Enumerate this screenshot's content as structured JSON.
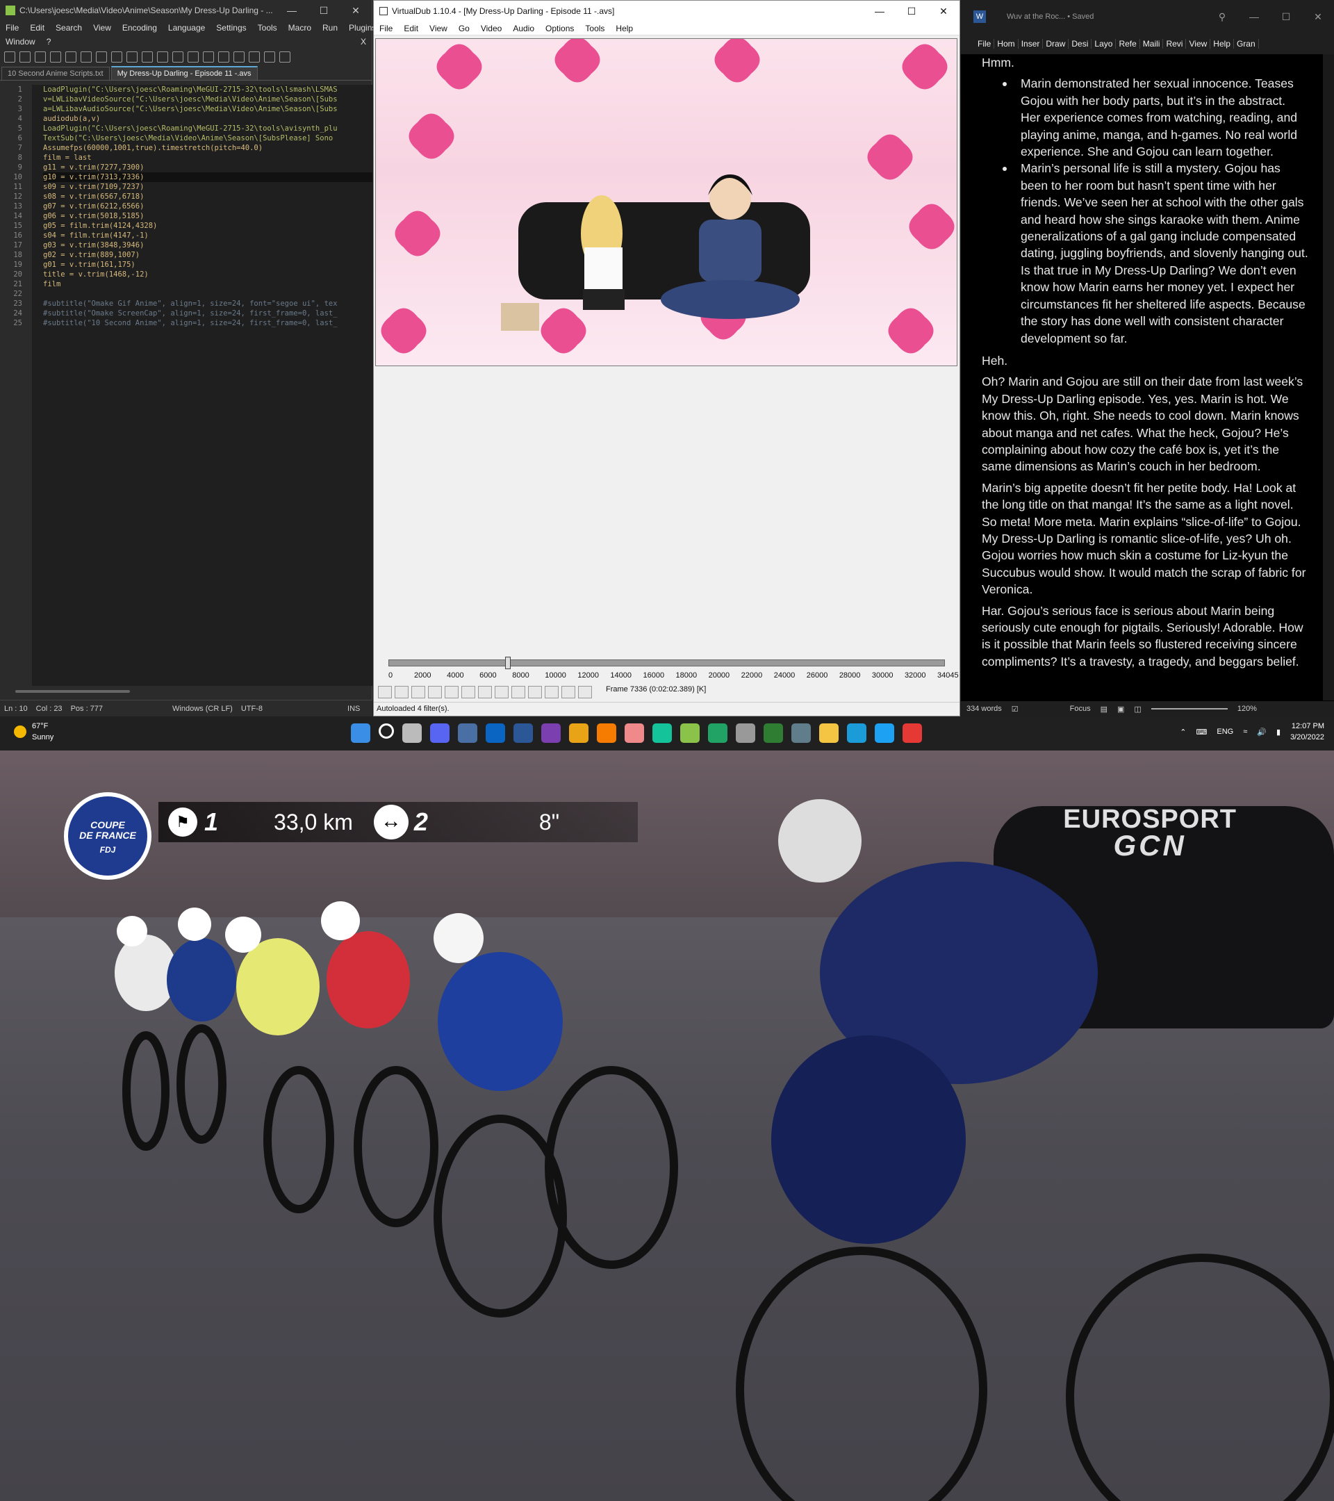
{
  "notepadpp": {
    "title": "C:\\Users\\joesc\\Media\\Video\\Anime\\Season\\My Dress-Up Darling - ...",
    "menu": [
      "File",
      "Edit",
      "Search",
      "View",
      "Encoding",
      "Language",
      "Settings",
      "Tools",
      "Macro",
      "Run",
      "Plugins",
      "Window",
      "?"
    ],
    "menu_close": "X",
    "tabs": [
      "10 Second Anime Scripts.txt",
      "My Dress-Up Darling - Episode 11 -.avs"
    ],
    "line_numbers": [
      "1",
      "2",
      "3",
      "4",
      "5",
      "6",
      "7",
      "8",
      "9",
      "10",
      "11",
      "12",
      "13",
      "14",
      "15",
      "16",
      "17",
      "18",
      "19",
      "20",
      "21",
      "22",
      "23",
      "24",
      "25"
    ],
    "code": [
      "LoadPlugin(\"C:\\Users\\joesc\\Roaming\\MeGUI-2715-32\\tools\\lsmash\\LSMAS",
      "v=LWLibavVideoSource(\"C:\\Users\\joesc\\Media\\Video\\Anime\\Season\\[Subs",
      "a=LWLibavAudioSource(\"C:\\Users\\joesc\\Media\\Video\\Anime\\Season\\[Subs",
      "audiodub(a,v)",
      "LoadPlugin(\"C:\\Users\\joesc\\Roaming\\MeGUI-2715-32\\tools\\avisynth_plu",
      "TextSub(\"C:\\Users\\joesc\\Media\\Video\\Anime\\Season\\[SubsPlease] Sono",
      "Assumefps(60000,1001,true).timestretch(pitch=40.0)",
      "film = last",
      "g11 = v.trim(7277,7300)",
      "g10 = v.trim(7313,7336)",
      "s09 = v.trim(7109,7237)",
      "s08 = v.trim(6567,6718)",
      "g07 = v.trim(6212,6566)",
      "g06 = v.trim(5018,5185)",
      "g05 = film.trim(4124,4328)",
      "s04 = film.trim(4147,-1)",
      "g03 = v.trim(3848,3946)",
      "g02 = v.trim(889,1007)",
      "g01 = v.trim(161,175)",
      "title = v.trim(1468,-12)",
      "film",
      "",
      "#subtitle(\"Omake Gif Anime\", align=1, size=24, font=\"segoe ui\", tex",
      "#subtitle(\"Omake ScreenCap\", align=1, size=24, first_frame=0, last_",
      "#subtitle(\"10 Second Anime\", align=1, size=24, first_frame=0, last_"
    ],
    "status": {
      "ln": "Ln : 10",
      "col": "Col : 23",
      "pos": "Pos : 777",
      "eol": "Windows (CR LF)",
      "enc": "UTF-8",
      "mode": "INS"
    }
  },
  "vdub": {
    "title": "VirtualDub 1.10.4 - [My Dress-Up Darling - Episode 11 -.avs]",
    "menu": [
      "File",
      "Edit",
      "View",
      "Go",
      "Video",
      "Audio",
      "Options",
      "Tools",
      "Help"
    ],
    "ticks": [
      "0",
      "2000",
      "4000",
      "6000",
      "8000",
      "10000",
      "12000",
      "14000",
      "16000",
      "18000",
      "20000",
      "22000",
      "24000",
      "26000",
      "28000",
      "30000",
      "32000",
      "34045"
    ],
    "frame_info": "Frame 7336 (0:02:02.389) [K]",
    "status": "Autoloaded 4 filter(s).",
    "position_fraction": 0.2155
  },
  "word": {
    "title": "Wuv at the Roc... • Saved",
    "ribbon": [
      "File",
      "Hom",
      "Inser",
      "Draw",
      "Desi",
      "Layo",
      "Refe",
      "Maili",
      "Revi",
      "View",
      "Help",
      "Gran"
    ],
    "p_hmm": "Hmm.",
    "bullets": [
      "Marin demonstrated her sexual innocence. Teases Gojou with her body parts, but it’s in the abstract. Her experience comes from watching, reading, and playing anime, manga, and h-games. No real world experience. She and Gojou can learn together.",
      "Marin’s personal life is still a mystery. Gojou has been to her room but hasn’t spent time with her friends. We’ve seen her at school with the other gals and heard how she sings karaoke with them. Anime generalizations of a gal gang include compensated dating, juggling boyfriends, and slovenly hanging out. Is that true in My Dress-Up Darling? We don’t even know how Marin earns her money yet. I expect her circumstances fit her sheltered life aspects. Because the story has done well with consistent character development so far."
    ],
    "p_heh": "Heh.",
    "paragraphs": [
      "Oh? Marin and Gojou are still on their date from last week’s My Dress-Up Darling episode. Yes, yes. Marin is hot. We know this. Oh, right. She needs to cool down. Marin knows about manga and net cafes. What the heck, Gojou? He’s complaining about how cozy the café box is, yet it’s the same dimensions as Marin’s couch in her bedroom.",
      "Marin’s big appetite doesn’t fit her petite body. Ha! Look at the long title on that manga! It’s the same as a light novel. So meta! More meta. Marin explains “slice-of-life” to Gojou. My Dress-Up Darling is romantic slice-of-life, yes? Uh oh. Gojou worries how much skin a costume for Liz-kyun the Succubus would show. It would match the scrap of fabric for Veronica.",
      "Har. Gojou’s serious face is serious about Marin being seriously cute enough for pigtails. Seriously! Adorable. How is it possible that Marin feels so flustered receiving sincere compliments? It’s a travesty, a tragedy, and beggars belief."
    ],
    "status": {
      "words": "334 words",
      "focus": "Focus",
      "zoom": "120%"
    }
  },
  "taskbar": {
    "temp": "67°F",
    "weather": "Sunny",
    "lang": "ENG",
    "time": "12:07 PM",
    "date": "3/20/2022",
    "app_icons": [
      "windows-start",
      "search",
      "task-view",
      "discord",
      "qbittorrent",
      "outlook",
      "word",
      "onenote",
      "photos",
      "blogger",
      "avatar-app",
      "grammarly",
      "notepad-plus-plus",
      "excel-green",
      "virtualdub",
      "file-manager",
      "calculator",
      "file-explorer",
      "edge",
      "twitter",
      "gcn"
    ]
  },
  "video": {
    "hud": {
      "logo_line1": "COUPE",
      "logo_line2": "DE FRANCE",
      "logo_badge": "FDJ",
      "position": "1",
      "distance": "33,0 km",
      "group": "2",
      "gap": "8\""
    },
    "broadcaster_line1": "EUROSPORT",
    "broadcaster_line2": "GCN"
  },
  "colors": {
    "npp_bg": "#1f1f1f",
    "vdub_bg": "#f0f0f0",
    "word_bg": "#000000",
    "taskbar": "#202020",
    "hud_blue": "#1f3b8f"
  }
}
